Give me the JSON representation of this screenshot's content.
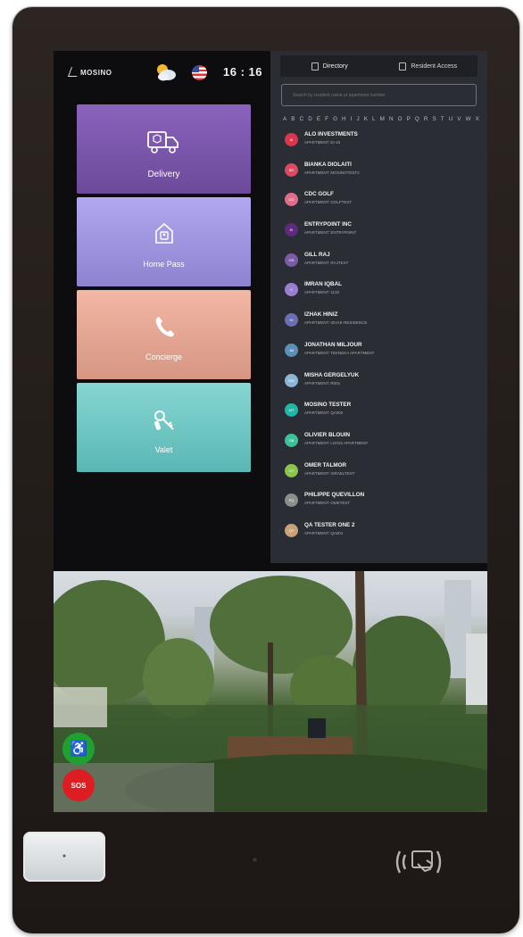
{
  "app": {
    "logo_text": "MOSINO",
    "time": "16 : 16"
  },
  "tiles": [
    {
      "label": "Delivery",
      "icon": "delivery-truck-icon"
    },
    {
      "label": "Home Pass",
      "icon": "home-pass-icon"
    },
    {
      "label": "Concierge",
      "icon": "phone-icon"
    },
    {
      "label": "Valet",
      "icon": "car-keys-icon"
    }
  ],
  "directory": {
    "tabs": [
      {
        "label": "Directory",
        "icon": "directory-icon",
        "active": true
      },
      {
        "label": "Resident Access",
        "icon": "resident-access-icon",
        "active": false
      }
    ],
    "search_placeholder": "Search by resident name or apartment number",
    "alphabet": [
      "A",
      "B",
      "C",
      "D",
      "E",
      "F",
      "G",
      "H",
      "I",
      "J",
      "K",
      "L",
      "M",
      "N",
      "O",
      "P",
      "Q",
      "R",
      "S",
      "T",
      "U",
      "V",
      "W",
      "X"
    ],
    "residents": [
      {
        "initials": "AI",
        "name": "ALO INVESTMENTS",
        "apartment": "APARTMENT: EI-18",
        "color": "#d9364f"
      },
      {
        "initials": "BD",
        "name": "BIANKA DIOLAITI",
        "apartment": "APARTMENT: MOSINOTEST2",
        "color": "#d94a63"
      },
      {
        "initials": "CG",
        "name": "CDC GOLF",
        "apartment": "APARTMENT: GOLFTEST",
        "color": "#e06c8a"
      },
      {
        "initials": "EI",
        "name": "ENTRYPOINT INC",
        "apartment": "APARTMENT: ENTRYPOINT",
        "color": "#5e2a7e"
      },
      {
        "initials": "GR",
        "name": "GILL RAJ",
        "apartment": "APARTMENT: RAJTEST",
        "color": "#7c5aa8"
      },
      {
        "initials": "II",
        "name": "IMRAN IQBAL",
        "apartment": "APARTMENT: 1133",
        "color": "#9a7fd1"
      },
      {
        "initials": "IH",
        "name": "IZHAK HINIZ",
        "apartment": "APARTMENT: IZHAK-RESIDENCE",
        "color": "#6a6fb2"
      },
      {
        "initials": "JM",
        "name": "JONATHAN MILJOUR",
        "apartment": "APARTMENT: TEKNEKA APARTMENT",
        "color": "#5b8fb8"
      },
      {
        "initials": "MG",
        "name": "MISHA GERGELYUK",
        "apartment": "APARTMENT: R001",
        "color": "#8cb6d6"
      },
      {
        "initials": "MT",
        "name": "MOSINO TESTER",
        "apartment": "APARTMENT: QA002",
        "color": "#1fb7a8"
      },
      {
        "initials": "OB",
        "name": "OLIVIER BLOUIN",
        "apartment": "APARTMENT: LOGIS APARTMENT",
        "color": "#3cc29a"
      },
      {
        "initials": "OT",
        "name": "OMER TALMOR",
        "apartment": "APARTMENT: ISRAELTEST",
        "color": "#8ac64a"
      },
      {
        "initials": "PQ",
        "name": "PHILIPPE QUEVILLON",
        "apartment": "APARTMENT: OMETEST",
        "color": "#8a8f8a"
      },
      {
        "initials": "QT",
        "name": "QA TESTER ONE 2",
        "apartment": "APARTMENT: QA001",
        "color": "#c9a27a"
      }
    ]
  },
  "buttons": {
    "accessibility_icon": "wheelchair-icon",
    "sos_label": "SOS"
  }
}
